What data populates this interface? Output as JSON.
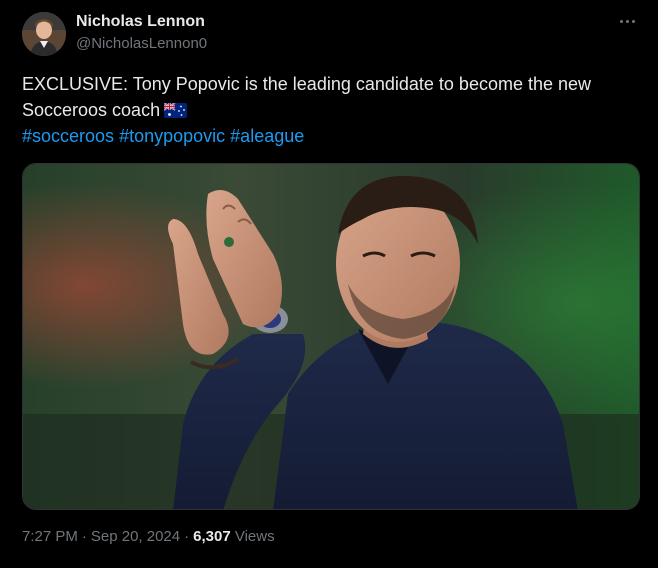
{
  "author": {
    "name": "Nicholas Lennon",
    "handle": "@NicholasLennon0"
  },
  "tweet": {
    "text": "EXCLUSIVE: Tony Popovic is the leading candidate to become the new Socceroos coach",
    "flag_icon": "australia-flag-icon",
    "hashtags": [
      "#socceroos",
      "#tonypopovic",
      "#aleague"
    ]
  },
  "meta": {
    "time": "7:27 PM",
    "separator": "·",
    "date": "Sep 20, 2024",
    "views_count": "6,307",
    "views_label": "Views"
  },
  "colors": {
    "background": "#000000",
    "text": "#e7e9ea",
    "muted": "#71767b",
    "link": "#1d9bf0"
  }
}
